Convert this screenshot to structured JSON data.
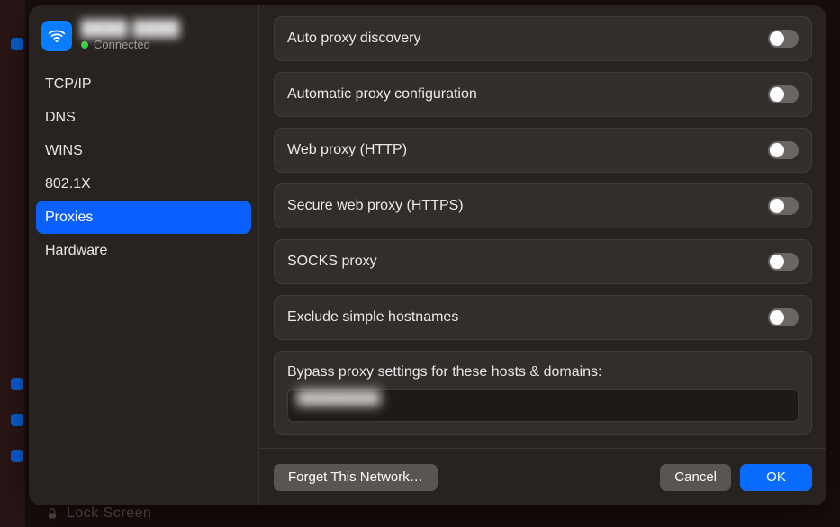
{
  "network": {
    "name": "████ ████",
    "status_label": "Connected"
  },
  "sidebar": {
    "items": [
      {
        "label": "TCP/IP"
      },
      {
        "label": "DNS"
      },
      {
        "label": "WINS"
      },
      {
        "label": "802.1X"
      },
      {
        "label": "Proxies"
      },
      {
        "label": "Hardware"
      }
    ],
    "selected_index": 4
  },
  "proxies": {
    "rows": [
      {
        "label": "Auto proxy discovery",
        "on": false
      },
      {
        "label": "Automatic proxy configuration",
        "on": false
      },
      {
        "label": "Web proxy (HTTP)",
        "on": false
      },
      {
        "label": "Secure web proxy (HTTPS)",
        "on": false
      },
      {
        "label": "SOCKS proxy",
        "on": false
      },
      {
        "label": "Exclude simple hostnames",
        "on": false
      }
    ],
    "bypass": {
      "label": "Bypass proxy settings for these hosts & domains:",
      "value": "████████"
    }
  },
  "footer": {
    "forget_label": "Forget This Network…",
    "cancel_label": "Cancel",
    "ok_label": "OK"
  },
  "background": {
    "lock_label": "Lock Screen"
  }
}
